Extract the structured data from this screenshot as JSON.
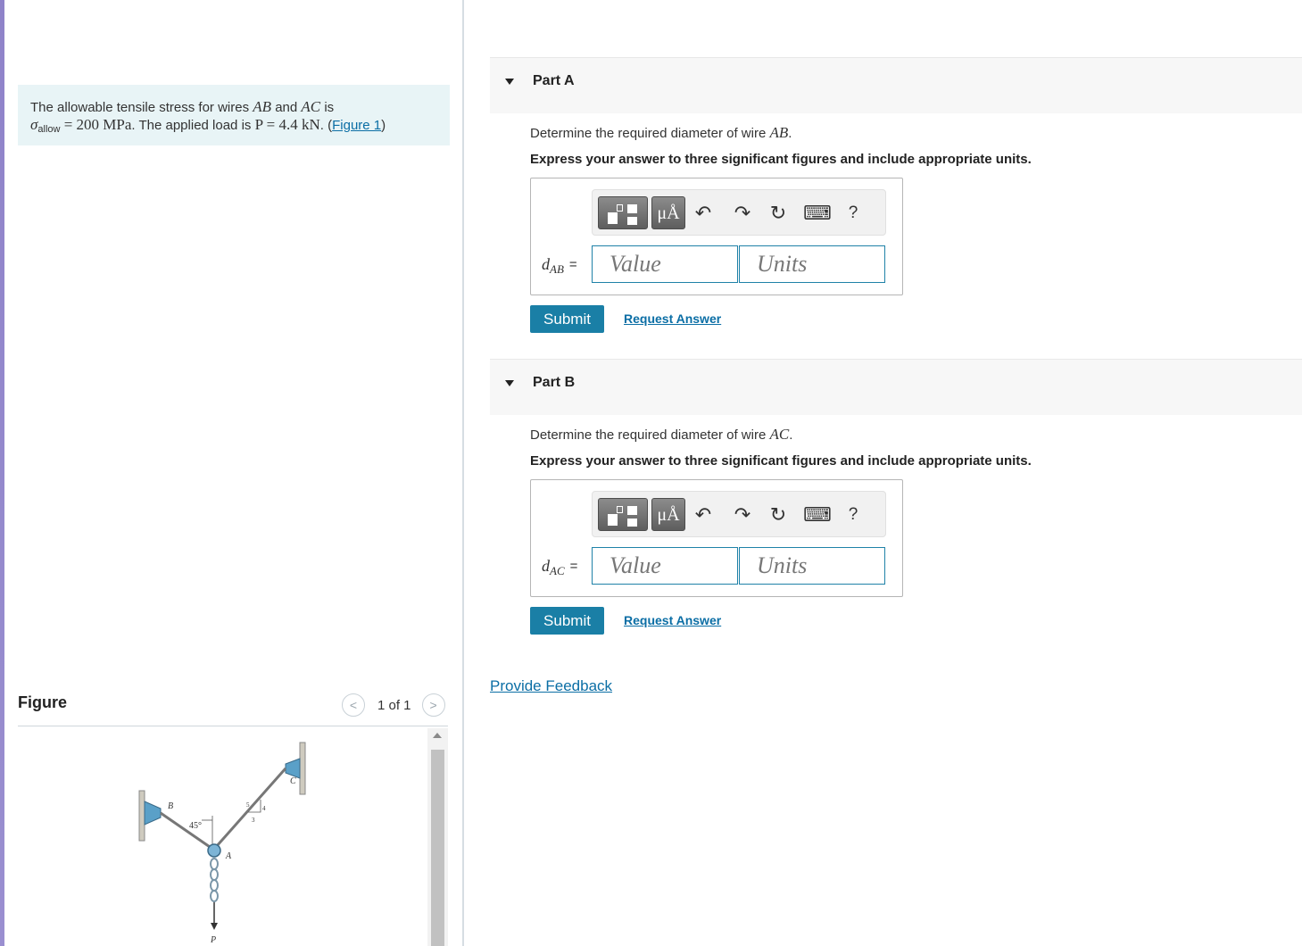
{
  "problem": {
    "text_1": "The allowable tensile stress for wires ",
    "ab": "AB",
    "and": " and ",
    "ac": "AC",
    "is": " is",
    "sigma": "σ",
    "sigma_sub": "allow",
    "stress_eq": " = 200 MPa",
    "text_2": ". The applied load is ",
    "p_eq": "P = 4.4 kN",
    "text_3": ". (",
    "figure_link": "Figure 1",
    "text_4": ")"
  },
  "figure": {
    "title": "Figure",
    "pager_prev": "<",
    "pager_count": "1 of 1",
    "pager_next": ">",
    "labels": {
      "b": "B",
      "c": "C",
      "a": "A",
      "p": "P",
      "angle": "45°",
      "five": "5",
      "four": "4",
      "three": "3"
    }
  },
  "parts": [
    {
      "label": "Part A",
      "question_prefix": "Determine the required diameter of wire ",
      "question_var": "AB",
      "question_suffix": ".",
      "instruction": "Express your answer to three significant figures and include appropriate units.",
      "var_main": "d",
      "var_sub": "AB",
      "var_eq": "=",
      "value_placeholder": "Value",
      "units_placeholder": "Units",
      "submit": "Submit",
      "request": "Request Answer"
    },
    {
      "label": "Part B",
      "question_prefix": "Determine the required diameter of wire ",
      "question_var": "AC",
      "question_suffix": ".",
      "instruction": "Express your answer to three significant figures and include appropriate units.",
      "var_main": "d",
      "var_sub": "AC",
      "var_eq": "=",
      "value_placeholder": "Value",
      "units_placeholder": "Units",
      "submit": "Submit",
      "request": "Request Answer"
    }
  ],
  "toolbar": {
    "units_label": "μÅ",
    "undo_icon": "↶",
    "redo_icon": "↷",
    "reset_icon": "↻",
    "keyboard_icon": "⌨",
    "help_label": "?"
  },
  "feedback_link": "Provide Feedback",
  "colors": {
    "accent": "#1a7fa6",
    "link": "#0b6ea5",
    "problem_bg": "#e8f4f6",
    "sidebar": "#8f83c9"
  }
}
